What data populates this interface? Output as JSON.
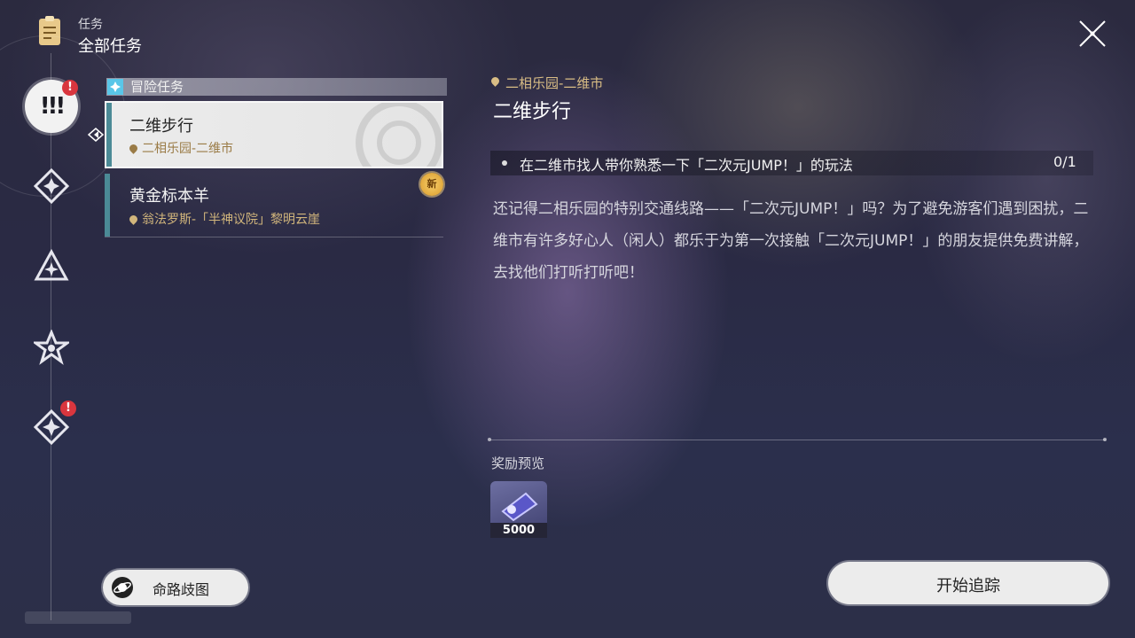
{
  "header": {
    "section": "任务",
    "title": "全部任务"
  },
  "sidebar": {
    "categories": [
      {
        "name": "adventure",
        "active": true,
        "alert": "!"
      },
      {
        "name": "category-2",
        "active": false
      },
      {
        "name": "category-3",
        "active": false
      },
      {
        "name": "category-4",
        "active": false
      },
      {
        "name": "category-5",
        "active": false,
        "alert": "!"
      }
    ]
  },
  "quest_list": {
    "section_label": "冒险任务",
    "items": [
      {
        "title": "二维步行",
        "location": "二相乐园-二维市",
        "selected": true
      },
      {
        "title": "黄金标本羊",
        "location": "翁法罗斯-「半神议院」黎明云崖",
        "badge": "新"
      }
    ]
  },
  "detail": {
    "location": "二相乐园-二维市",
    "title": "二维步行",
    "objective": {
      "text": "在二维市找人带你熟悉一下「二次元JUMP！」的玩法",
      "progress": "0/1"
    },
    "description": "还记得二相乐园的特别交通线路——「二次元JUMP！」吗？为了避免游客们遇到困扰，二维市有许多好心人（闲人）都乐于为第一次接触「二次元JUMP！」的朋友提供免费讲解，去找他们打听打听吧！",
    "reward_label": "奖励预览",
    "rewards": [
      {
        "icon": "credit-ticket-icon",
        "quantity": "5000"
      }
    ]
  },
  "buttons": {
    "path_map": "命路歧图",
    "start_tracking": "开始追踪"
  },
  "colors": {
    "accent_teal": "#4b8a96",
    "location_gold": "#d9bd85",
    "alert_red": "#d9363e",
    "section_cyan": "#59c6e8"
  }
}
